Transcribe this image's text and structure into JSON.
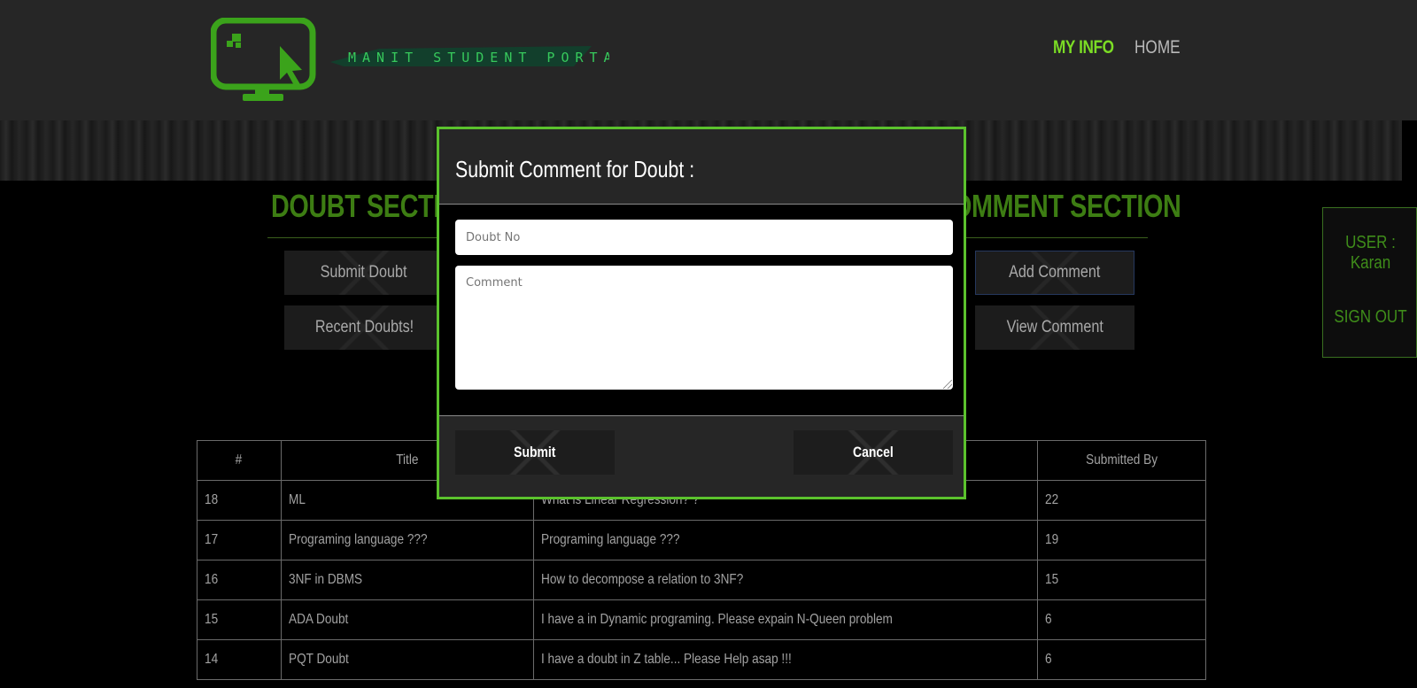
{
  "header": {
    "brand": "MANIT STUDENT PORTAL",
    "nav": {
      "myinfo": "MY INFO",
      "home": "HOME"
    }
  },
  "doubt_section": {
    "title": "DOUBT SECTION",
    "submit_label": "Submit Doubt",
    "recent_label": "Recent Doubts!"
  },
  "comment_section": {
    "title": "COMMENT SECTION",
    "visible_title": "OMMENT SECTION",
    "add_label": "Add Comment",
    "view_label": "View Comment"
  },
  "user": {
    "label": "USER : Karan",
    "signout": "SIGN OUT"
  },
  "table": {
    "headers": [
      "#",
      "Title",
      "",
      "Submitted By"
    ],
    "rows": [
      {
        "id": "18",
        "title": "ML",
        "desc": "What is Linear Regression? ?",
        "by": "22"
      },
      {
        "id": "17",
        "title": "Programing language ???",
        "desc": "Programing language ???",
        "by": "19"
      },
      {
        "id": "16",
        "title": "3NF in DBMS",
        "desc": "How to decompose a relation to 3NF?",
        "by": "15"
      },
      {
        "id": "15",
        "title": "ADA Doubt",
        "desc": "I have a in Dynamic programing. Please expain N-Queen problem",
        "by": "6"
      },
      {
        "id": "14",
        "title": "PQT Doubt",
        "desc": "I have a doubt in Z table... Please Help asap !!!",
        "by": "6"
      }
    ]
  },
  "modal": {
    "title": "Submit Comment for Doubt :",
    "doubt_placeholder": "Doubt No",
    "comment_placeholder": "Comment",
    "submit_label": "Submit",
    "cancel_label": "Cancel"
  },
  "colors": {
    "accent": "#5bc22d",
    "section_title": "#3d7d13",
    "nav_active": "#7bdc25"
  },
  "icons": {
    "logo": "monitor-cursor-icon"
  }
}
